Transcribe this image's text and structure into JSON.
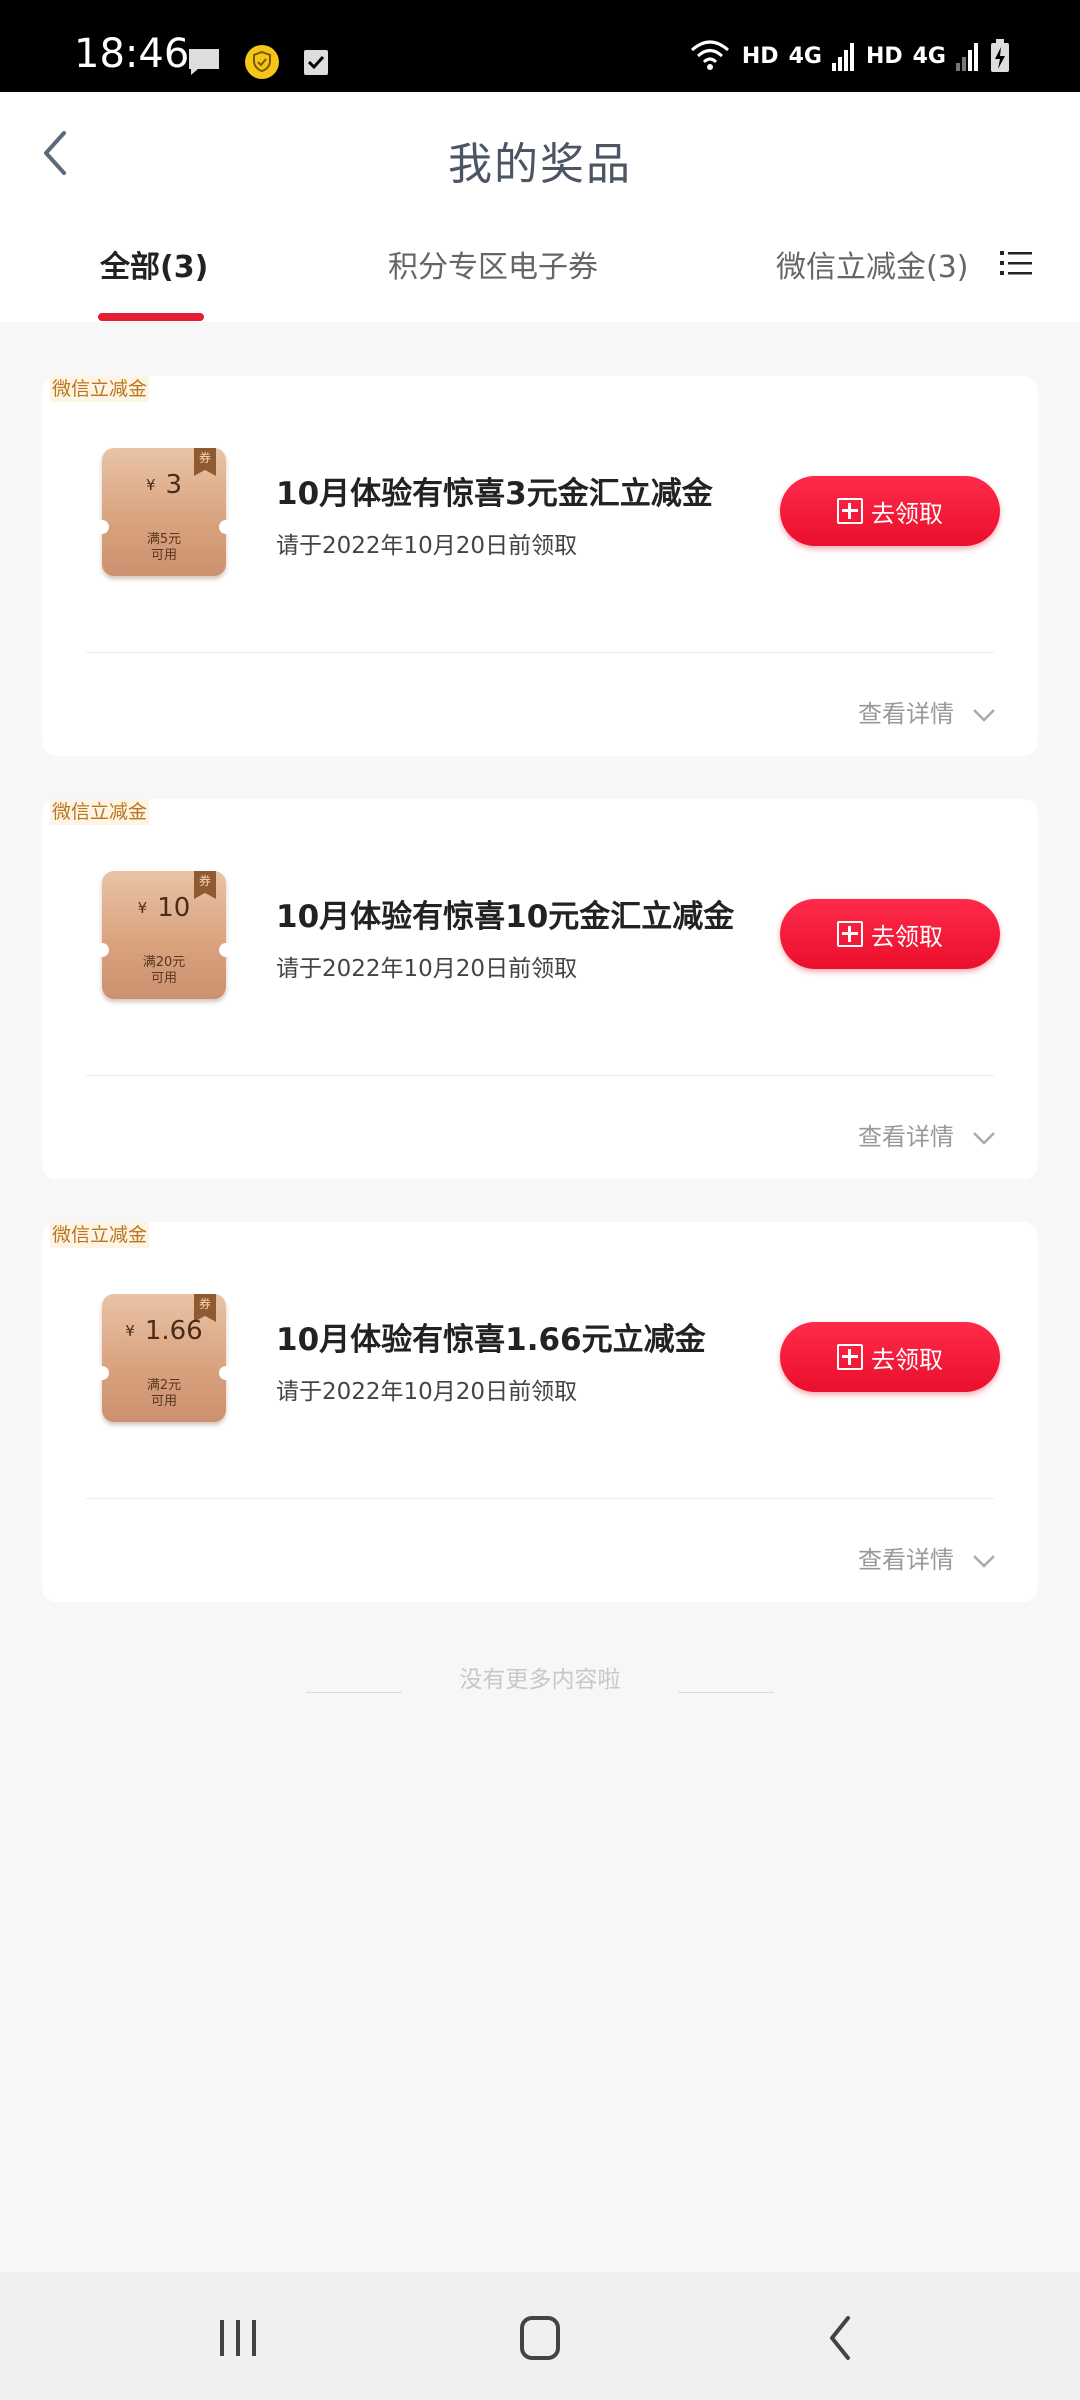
{
  "status_bar": {
    "time": "18:46",
    "hd1": "HD",
    "net1": "4G",
    "hd2": "HD",
    "net2": "4G",
    "icons": [
      "message-icon",
      "shield-icon",
      "checkbox-icon",
      "wifi-icon",
      "signal-icon",
      "battery-charging-icon"
    ]
  },
  "header": {
    "title": "我的奖品",
    "back_icon": "chevron-left-icon",
    "menu_icon": "list-icon"
  },
  "tabs": [
    {
      "label": "全部(3)",
      "active": true
    },
    {
      "label": "积分专区电子券",
      "active": false
    },
    {
      "label": "微信立减金(3)",
      "active": false
    }
  ],
  "prizes": [
    {
      "tag": "微信立减金",
      "coupon_ribbon": "券",
      "coupon_currency": "¥",
      "coupon_amount": "3",
      "coupon_condition_line1": "满5元",
      "coupon_condition_line2": "可用",
      "title": "10月体验有惊喜3元金汇立减金",
      "deadline": "请于2022年10月20日前领取",
      "claim_label": "去领取",
      "details_label": "查看详情"
    },
    {
      "tag": "微信立减金",
      "coupon_ribbon": "券",
      "coupon_currency": "¥",
      "coupon_amount": "10",
      "coupon_condition_line1": "满20元",
      "coupon_condition_line2": "可用",
      "title": "10月体验有惊喜10元金汇立减金",
      "deadline": "请于2022年10月20日前领取",
      "claim_label": "去领取",
      "details_label": "查看详情"
    },
    {
      "tag": "微信立减金",
      "coupon_ribbon": "券",
      "coupon_currency": "¥",
      "coupon_amount": "1.66",
      "coupon_condition_line1": "满2元",
      "coupon_condition_line2": "可用",
      "title": "10月体验有惊喜1.66元立减金",
      "deadline": "请于2022年10月20日前领取",
      "claim_label": "去领取",
      "details_label": "查看详情"
    }
  ],
  "footer_note": "没有更多内容啦",
  "colors": {
    "accent_red": "#e41c34",
    "tag_gold": "#b9761f",
    "coupon_bronze": "#d8a17c"
  },
  "nav_bar": {
    "buttons": [
      "recent-apps-icon",
      "home-icon",
      "back-icon"
    ]
  }
}
